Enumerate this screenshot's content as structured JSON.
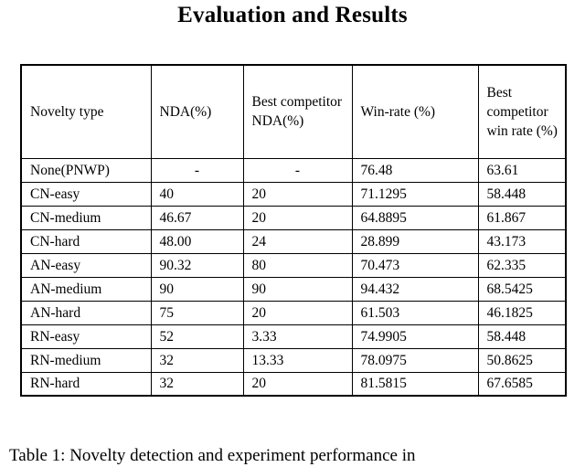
{
  "page": {
    "title": "Evaluation and Results"
  },
  "table": {
    "columns": [
      "Novelty type",
      "NDA(%)",
      "Best competitor NDA(%)",
      "Win-rate (%)",
      "Best competitor win rate (%)"
    ],
    "rows": [
      [
        "None(PNWP)",
        "-",
        "-",
        "76.48",
        "63.61"
      ],
      [
        "CN-easy",
        "40",
        "20",
        "71.1295",
        "58.448"
      ],
      [
        "CN-medium",
        "46.67",
        "20",
        "64.8895",
        "61.867"
      ],
      [
        "CN-hard",
        "48.00",
        "24",
        "28.899",
        "43.173"
      ],
      [
        "AN-easy",
        "90.32",
        "80",
        "70.473",
        "62.335"
      ],
      [
        "AN-medium",
        "90",
        "90",
        "94.432",
        "68.5425"
      ],
      [
        "AN-hard",
        "75",
        "20",
        "61.503",
        "46.1825"
      ],
      [
        "RN-easy",
        "52",
        "3.33",
        "74.9905",
        "58.448"
      ],
      [
        "RN-medium",
        "32",
        "13.33",
        "78.0975",
        "50.8625"
      ],
      [
        "RN-hard",
        "32",
        "20",
        "81.5815",
        "67.6585"
      ]
    ]
  },
  "caption": {
    "text": "Table 1: Novelty detection and experiment performance in"
  },
  "colors": {
    "page_background": "#ffffff",
    "text": "#000000",
    "table_border": "#000000"
  }
}
